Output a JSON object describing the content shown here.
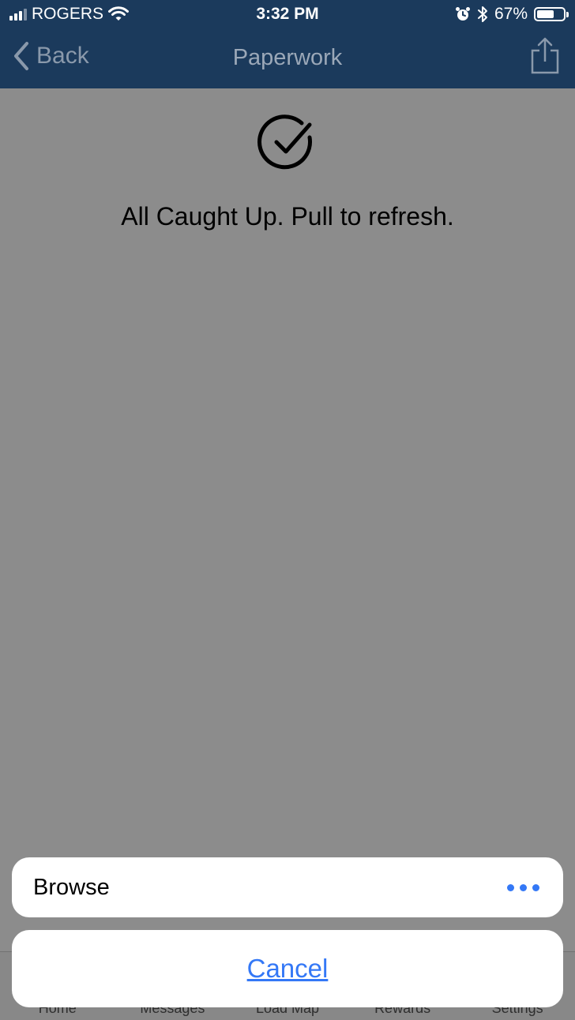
{
  "status_bar": {
    "carrier": "ROGERS",
    "time": "3:32 PM",
    "battery_percent": "67%",
    "battery_level": 0.67,
    "icons": [
      "signal-icon",
      "wifi-icon",
      "alarm-icon",
      "bluetooth-icon",
      "battery-icon"
    ]
  },
  "nav": {
    "back_label": "Back",
    "title": "Paperwork",
    "back_icon": "chevron-left-icon",
    "share_icon": "share-icon"
  },
  "empty_state": {
    "icon": "check-circle-icon",
    "message": "All Caught Up. Pull to refresh."
  },
  "tab_bar": {
    "items": [
      {
        "label": "Home"
      },
      {
        "label": "Messages"
      },
      {
        "label": "Load Map"
      },
      {
        "label": "Rewards"
      },
      {
        "label": "Settings"
      }
    ]
  },
  "action_sheet": {
    "option_label": "Browse",
    "option_icon": "more-dots-icon",
    "cancel_label": "Cancel"
  },
  "colors": {
    "nav_background": "#1b3a5c",
    "accent": "#3478f6",
    "overlay": "#8e8e90"
  }
}
